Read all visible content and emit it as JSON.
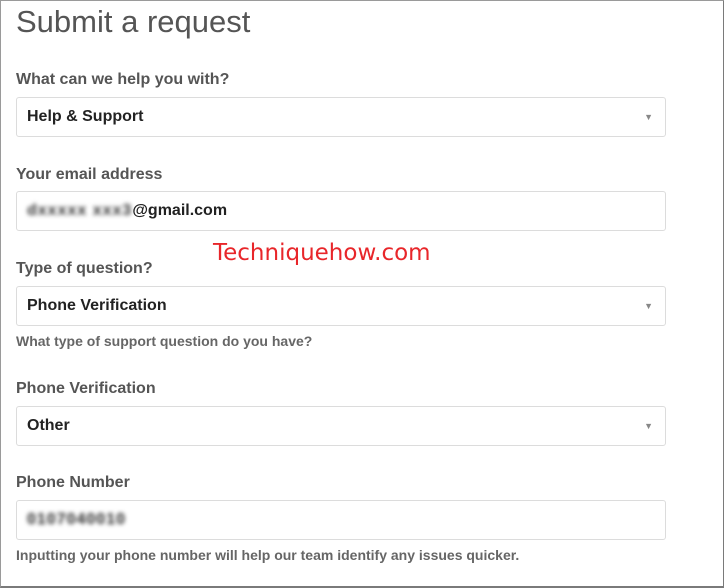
{
  "page": {
    "title": "Submit a request"
  },
  "help_with": {
    "label": "What can we help you with?",
    "value": "Help & Support"
  },
  "email": {
    "label": "Your email address",
    "masked_prefix": "dxxxxx xxx3",
    "value_suffix": "@gmail.com"
  },
  "watermark": "Techniquehow.com",
  "question_type": {
    "label": "Type of question?",
    "value": "Phone Verification",
    "hint": "What type of support question do you have?"
  },
  "phone_verification": {
    "label": "Phone Verification",
    "value": "Other"
  },
  "phone_number": {
    "label": "Phone Number",
    "masked_value": "0107040010",
    "hint": "Inputting your phone number will help our team identify any issues quicker."
  },
  "icons": {
    "dropdown": "dropdown-caret-icon"
  }
}
